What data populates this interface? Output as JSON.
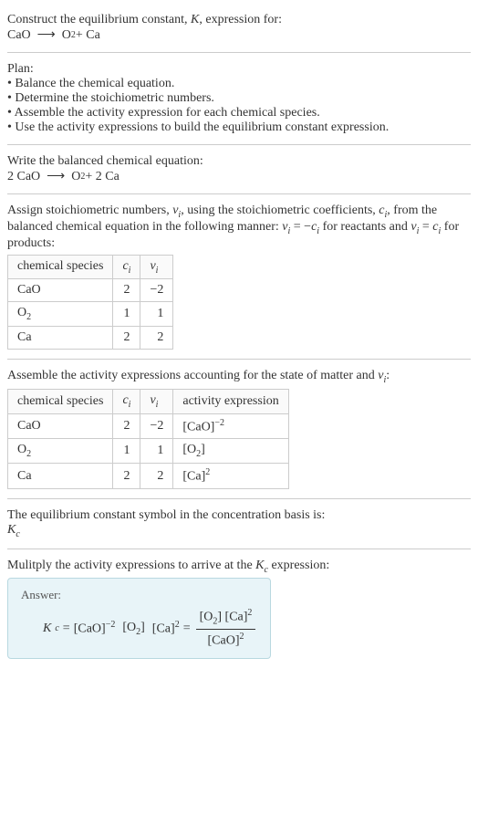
{
  "intro": {
    "line1": "Construct the equilibrium constant, ",
    "K": "K",
    "line1b": ", expression for:",
    "equation_lhs": "CaO",
    "arrow": "⟶",
    "equation_rhs_a": "O",
    "equation_rhs_sub": "2",
    "equation_rhs_b": " + Ca"
  },
  "plan": {
    "title": "Plan:",
    "item1": "• Balance the chemical equation.",
    "item2": "• Determine the stoichiometric numbers.",
    "item3": "• Assemble the activity expression for each chemical species.",
    "item4": "• Use the activity expressions to build the equilibrium constant expression."
  },
  "balanced": {
    "title": "Write the balanced chemical equation:",
    "lhs": "2 CaO",
    "arrow": "⟶",
    "rhs_a": "O",
    "rhs_sub": "2",
    "rhs_b": " + 2 Ca"
  },
  "stoich": {
    "intro_a": "Assign stoichiometric numbers, ",
    "nu_i": "ν",
    "sub_i": "i",
    "intro_b": ", using the stoichiometric coefficients, ",
    "c_i": "c",
    "intro_c": ", from the balanced chemical equation in the following manner: ",
    "eq1_a": "ν",
    "eq1_b": " = −",
    "eq1_c": "c",
    "intro_d": " for reactants and ",
    "eq2_a": "ν",
    "eq2_b": " = ",
    "eq2_c": "c",
    "intro_e": " for products:"
  },
  "table1": {
    "h1": "chemical species",
    "h2": "c",
    "h2sub": "i",
    "h3": "ν",
    "h3sub": "i",
    "r1c1": "CaO",
    "r1c2": "2",
    "r1c3": "−2",
    "r2c1a": "O",
    "r2c1sub": "2",
    "r2c2": "1",
    "r2c3": "1",
    "r3c1": "Ca",
    "r3c2": "2",
    "r3c3": "2"
  },
  "activity": {
    "title_a": "Assemble the activity expressions accounting for the state of matter and ",
    "nu": "ν",
    "sub_i": "i",
    "title_b": ":"
  },
  "table2": {
    "h1": "chemical species",
    "h2": "c",
    "h2sub": "i",
    "h3": "ν",
    "h3sub": "i",
    "h4": "activity expression",
    "r1c1": "CaO",
    "r1c2": "2",
    "r1c3": "−2",
    "r1c4a": "[CaO]",
    "r1c4sup": "−2",
    "r2c1a": "O",
    "r2c1sub": "2",
    "r2c2": "1",
    "r2c3": "1",
    "r2c4a": "[O",
    "r2c4sub": "2",
    "r2c4b": "]",
    "r3c1": "Ca",
    "r3c2": "2",
    "r3c3": "2",
    "r3c4a": "[Ca]",
    "r3c4sup": "2"
  },
  "basis": {
    "title": "The equilibrium constant symbol in the concentration basis is:",
    "K": "K",
    "sub": "c"
  },
  "multiply": {
    "title_a": "Mulitply the activity expressions to arrive at the ",
    "K": "K",
    "sub": "c",
    "title_b": " expression:"
  },
  "answer": {
    "label": "Answer:",
    "K": "K",
    "Ksub": "c",
    "eq": " = ",
    "t1a": "[CaO]",
    "t1sup": "−2",
    "sp1": " ",
    "t2a": "[O",
    "t2sub": "2",
    "t2b": "]",
    "sp2": " ",
    "t3a": "[Ca]",
    "t3sup": "2",
    "eq2": " = ",
    "num_a": "[O",
    "num_sub": "2",
    "num_b": "] [Ca]",
    "num_sup": "2",
    "den_a": "[CaO]",
    "den_sup": "2"
  },
  "chart_data": {
    "type": "table",
    "tables": [
      {
        "title": "Stoichiometric numbers",
        "columns": [
          "chemical species",
          "c_i",
          "ν_i"
        ],
        "rows": [
          [
            "CaO",
            2,
            -2
          ],
          [
            "O2",
            1,
            1
          ],
          [
            "Ca",
            2,
            2
          ]
        ]
      },
      {
        "title": "Activity expressions",
        "columns": [
          "chemical species",
          "c_i",
          "ν_i",
          "activity expression"
        ],
        "rows": [
          [
            "CaO",
            2,
            -2,
            "[CaO]^-2"
          ],
          [
            "O2",
            1,
            1,
            "[O2]"
          ],
          [
            "Ca",
            2,
            2,
            "[Ca]^2"
          ]
        ]
      }
    ]
  }
}
